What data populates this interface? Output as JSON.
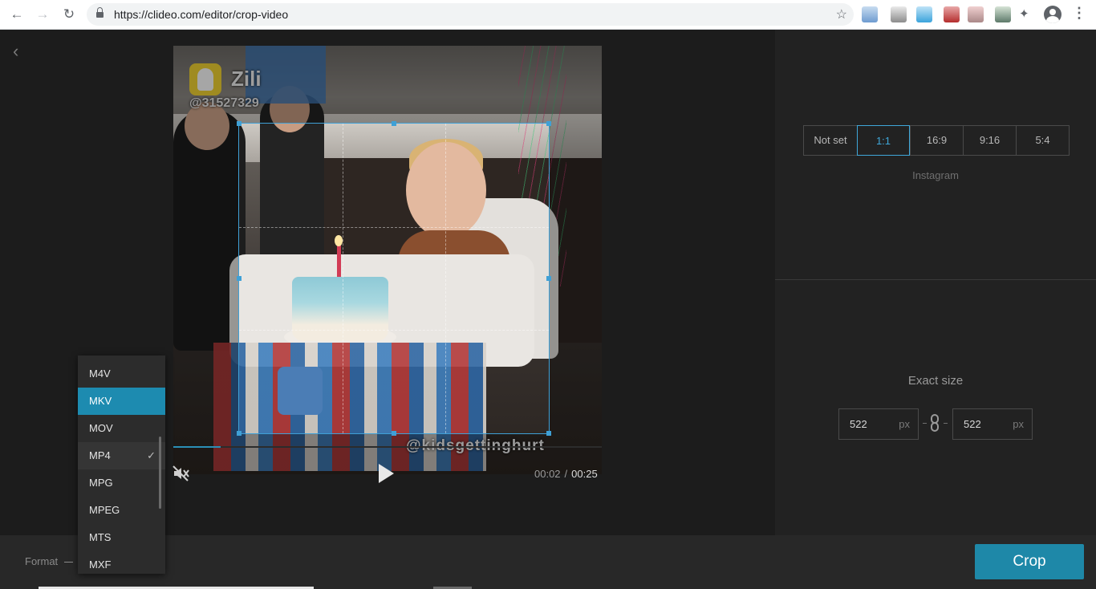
{
  "browser": {
    "url": "https://clideo.com/editor/crop-video"
  },
  "video": {
    "watermark_name": "Zili",
    "watermark_handle": "@31527329",
    "watermark_bottom": "@kidsgettinghurt",
    "current_time": "00:02",
    "time_separator": "/",
    "duration": "00:25",
    "progress_fraction": 0.11
  },
  "aspect": {
    "options": [
      "Not set",
      "1:1",
      "16:9",
      "9:16",
      "5:4"
    ],
    "selected": "1:1",
    "caption": "Instagram"
  },
  "exact_size": {
    "label": "Exact size",
    "width": "522",
    "height": "522",
    "unit": "px"
  },
  "format": {
    "label": "Format",
    "options": [
      "M4V",
      "MKV",
      "MOV",
      "MP4",
      "MPG",
      "MPEG",
      "MTS",
      "MXF"
    ],
    "highlighted": "MKV",
    "selected": "MP4"
  },
  "actions": {
    "crop_label": "Crop"
  },
  "colors": {
    "accent": "#1e88a8",
    "crop_frame": "#3fa0d6"
  }
}
